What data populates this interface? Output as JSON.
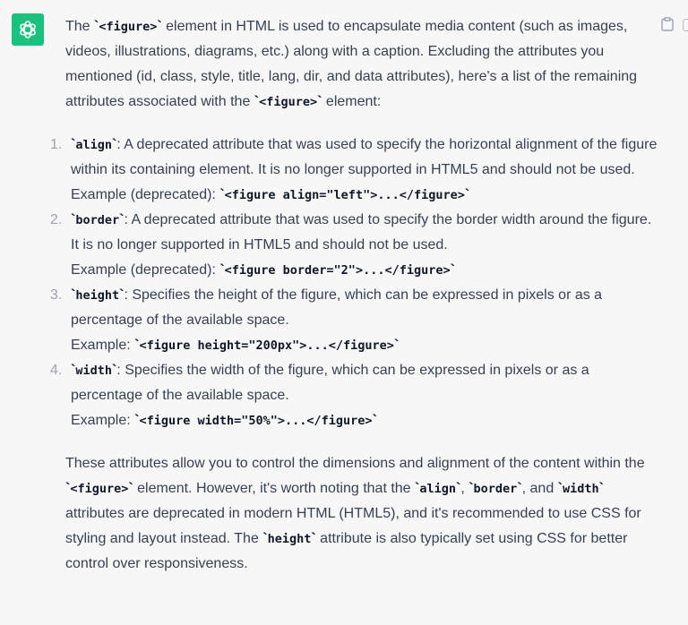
{
  "assistant": {
    "avatar_icon": "openai-logo-icon",
    "avatar_color": "#19c37d",
    "copy_icon": "clipboard-icon"
  },
  "message": {
    "intro": {
      "t1": "The ",
      "c1": "<figure>",
      "t2": " element in HTML is used to encapsulate media content (such as images, videos, illustrations, diagrams, etc.) along with a caption. Excluding the attributes you mentioned (id, class, style, title, lang, dir, and data attributes), here's a list of the remaining attributes associated with the ",
      "c2": "<figure>",
      "t3": " element:"
    },
    "items": [
      {
        "number": "1.",
        "code": "align",
        "description": ": A deprecated attribute that was used to specify the horizontal alignment of the figure within its containing element. It is no longer supported in HTML5 and should not be used.",
        "example_label": "Example (deprecated): ",
        "example_code": "<figure align=\"left\">...</figure>"
      },
      {
        "number": "2.",
        "code": "border",
        "description": ": A deprecated attribute that was used to specify the border width around the figure. It is no longer supported in HTML5 and should not be used.",
        "example_label": "Example (deprecated): ",
        "example_code": "<figure border=\"2\">...</figure>"
      },
      {
        "number": "3.",
        "code": "height",
        "description": ": Specifies the height of the figure, which can be expressed in pixels or as a percentage of the available space.",
        "example_label": "Example: ",
        "example_code": "<figure height=\"200px\">...</figure>"
      },
      {
        "number": "4.",
        "code": "width",
        "description": ": Specifies the width of the figure, which can be expressed in pixels or as a percentage of the available space.",
        "example_label": "Example: ",
        "example_code": "<figure width=\"50%\">...</figure>"
      }
    ],
    "outro": {
      "t1": "These attributes allow you to control the dimensions and alignment of the content within the ",
      "c1": "<figure>",
      "t2": " element. However, it's worth noting that the ",
      "c2": "align",
      "t3": ", ",
      "c3": "border",
      "t4": ", and ",
      "c4": "width",
      "t5": " attributes are deprecated in modern HTML (HTML5), and it's recommended to use CSS for styling and layout instead. The ",
      "c5": "height",
      "t6": " attribute is also typically set using CSS for better control over responsiveness."
    }
  }
}
